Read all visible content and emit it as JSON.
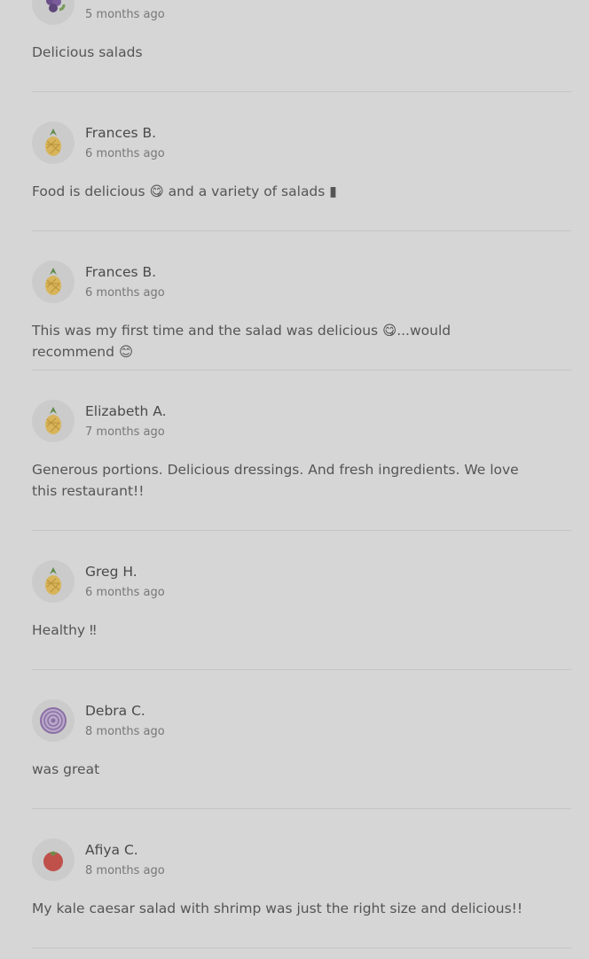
{
  "reviews": [
    {
      "name": "",
      "time": "5 months ago",
      "text": "Delicious salads",
      "icon": "grape-icon"
    },
    {
      "name": "Frances B.",
      "time": "6 months ago",
      "text": "Food is delicious 😋 and a variety of salads ▮",
      "icon": "pineapple-icon"
    },
    {
      "name": "Frances B.",
      "time": "6 months ago",
      "text": "This was my first time and the salad was delicious 😋...would recommend 😊",
      "icon": "pineapple-icon"
    },
    {
      "name": "Elizabeth A.",
      "time": "7 months ago",
      "text": "Generous portions. Delicious dressings. And fresh ingredients. We love this restaurant!!",
      "icon": "pineapple-icon"
    },
    {
      "name": "Greg H.",
      "time": "6 months ago",
      "text": "Healthy ‼",
      "icon": "pineapple-icon"
    },
    {
      "name": "Debra C.",
      "time": "8 months ago",
      "text": "was great",
      "icon": "onion-icon"
    },
    {
      "name": "Afiya C.",
      "time": "8 months ago",
      "text": "My kale caesar salad with shrimp was just the right size and delicious!!",
      "icon": "tomato-icon"
    }
  ]
}
